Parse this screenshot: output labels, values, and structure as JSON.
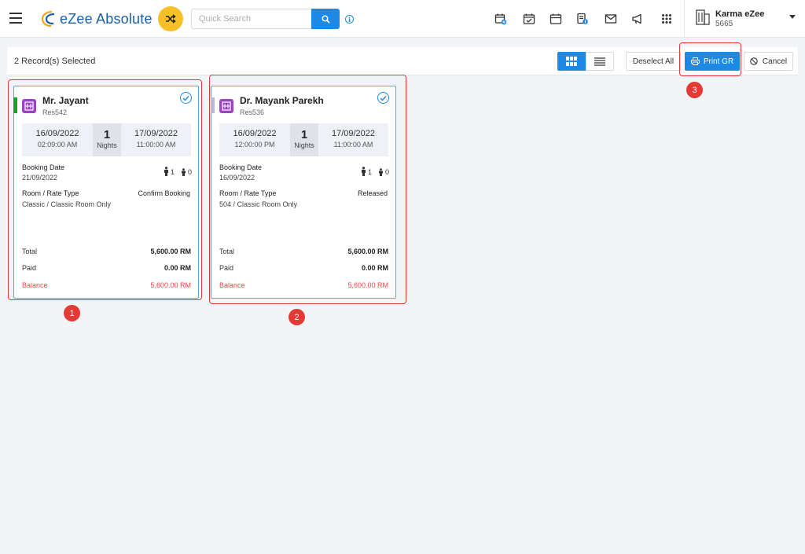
{
  "topbar": {
    "brand": "eZee Absolute",
    "search_placeholder": "Quick Search",
    "info_glyph": "i",
    "icons": [
      "calendar-plus-icon",
      "calendar-check-icon",
      "calendar-icon",
      "invoice-icon",
      "mail-icon",
      "megaphone-icon",
      "apps-grid-icon"
    ],
    "hotel_name": "Karma eZee",
    "hotel_code": "5665"
  },
  "actionbar": {
    "selected_text": "2 Record(s) Selected",
    "deselect_label": "Deselect All",
    "print_label": "Print GR",
    "cancel_label": "Cancel"
  },
  "cards": [
    {
      "guest_name": "Mr. Jayant",
      "res_no": "Res542",
      "status_color": "#17a12f",
      "arrival_date": "16/09/2022",
      "arrival_time": "02:09:00 AM",
      "nights": "1",
      "nights_label": "Nights",
      "departure_date": "17/09/2022",
      "departure_time": "11:00:00 AM",
      "booking_date_label": "Booking Date",
      "booking_date": "21/09/2022",
      "adults": "1",
      "children": "0",
      "room_rate_label": "Room / Rate Type",
      "room_rate": "Classic / Classic Room Only",
      "status": "Confirm Booking",
      "total_label": "Total",
      "total": "5,600.00 RM",
      "paid_label": "Paid",
      "paid": "0.00 RM",
      "balance_label": "Balance",
      "balance": "5,600.00 RM"
    },
    {
      "guest_name": "Dr. Mayank Parekh",
      "res_no": "Res536",
      "status_color": "#b9bec5",
      "arrival_date": "16/09/2022",
      "arrival_time": "12:00:00 PM",
      "nights": "1",
      "nights_label": "Nights",
      "departure_date": "17/09/2022",
      "departure_time": "11:00:00 AM",
      "booking_date_label": "Booking Date",
      "booking_date": "16/09/2022",
      "adults": "1",
      "children": "0",
      "room_rate_label": "Room / Rate Type",
      "room_rate": "504 / Classic Room Only",
      "status": "Released",
      "total_label": "Total",
      "total": "5,600.00 RM",
      "paid_label": "Paid",
      "paid": "0.00 RM",
      "balance_label": "Balance",
      "balance": "5,600.00 RM"
    }
  ],
  "annotations": [
    "1",
    "2",
    "3"
  ],
  "colors": {
    "accent": "#1e88e5",
    "shuffle": "#f7c028",
    "balance": "#ef4444",
    "annotation": "#e53935",
    "room_icon": "#9c43c4"
  }
}
